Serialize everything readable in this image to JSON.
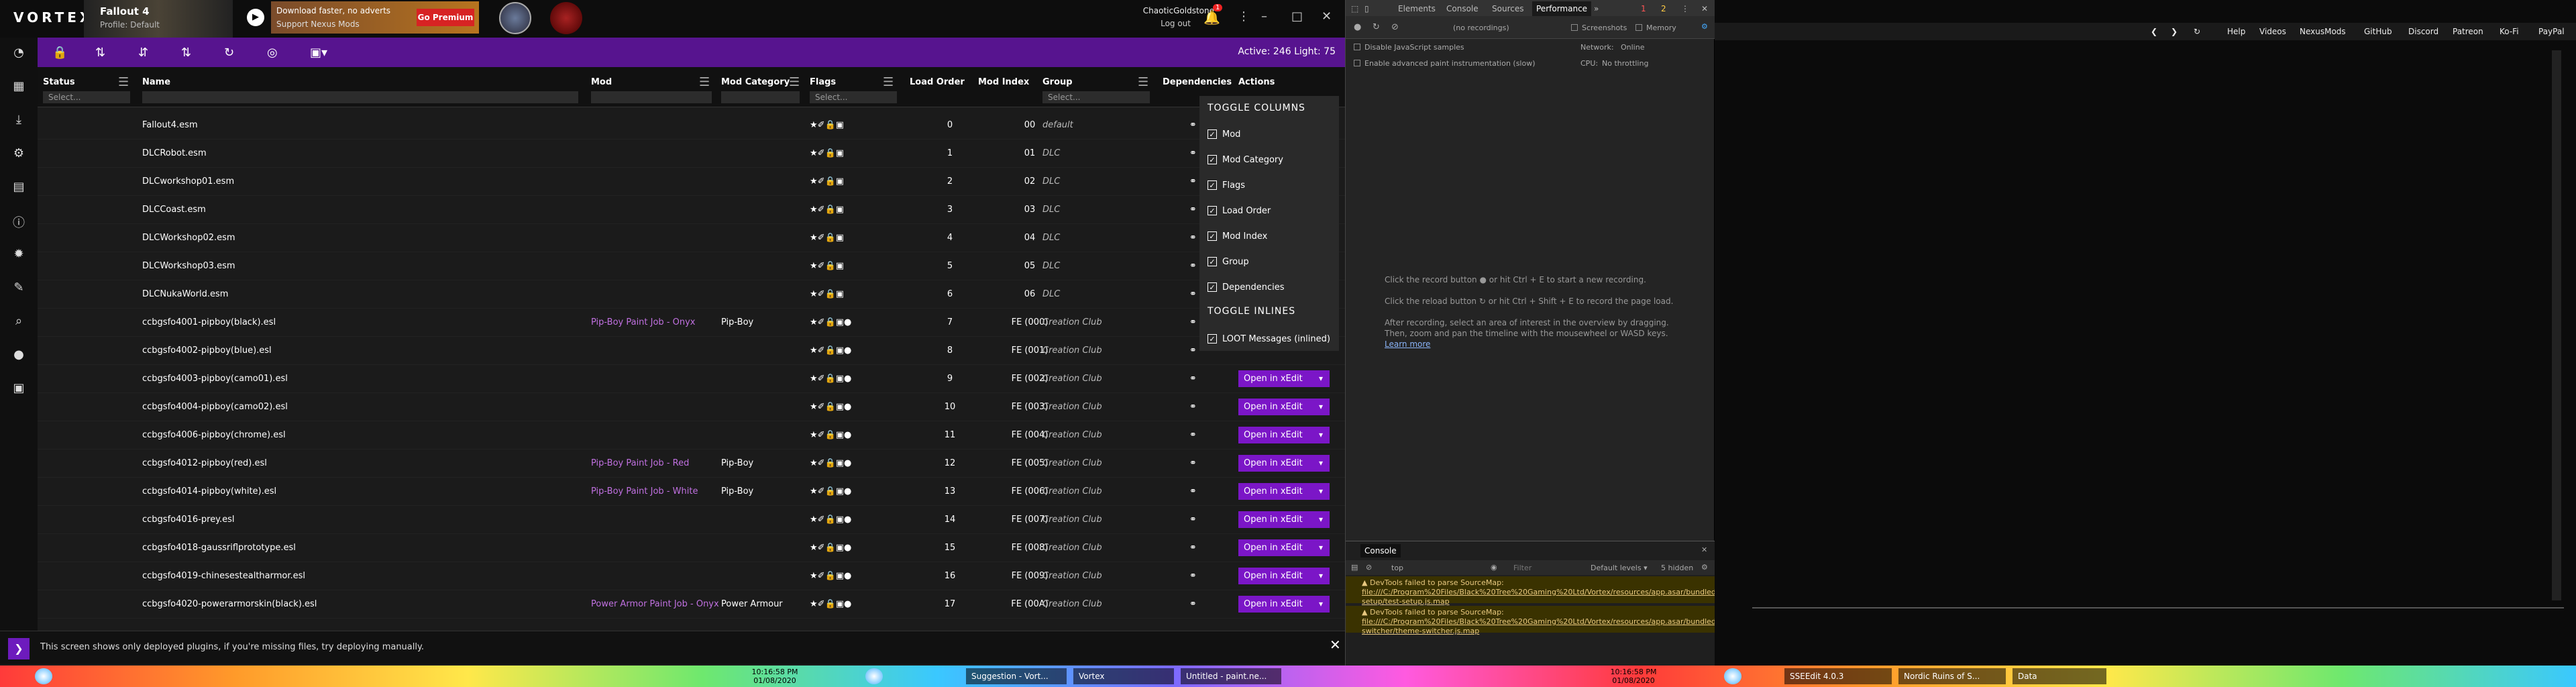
{
  "app": {
    "brand": "VORTEX",
    "game": "Fallout 4",
    "profile": "Profile: Default",
    "promo_title": "Download faster, no adverts",
    "promo_sub": "Support Nexus Mods",
    "premium": "Go Premium",
    "user": "ChaoticGoldstone",
    "logout": "Log out",
    "badge": "1",
    "active": "Active: 246 Light: 75"
  },
  "columns": {
    "status": "Status",
    "name": "Name",
    "mod": "Mod",
    "category": "Mod Category",
    "flags": "Flags",
    "load_order": "Load Order",
    "mod_index": "Mod Index",
    "group": "Group",
    "deps": "Dependencies",
    "actions": "Actions",
    "select": "Select..."
  },
  "rows": [
    {
      "name": "Fallout4.esm",
      "mod": "",
      "cat": "",
      "flags": "★✐🔒▣",
      "lo": "0",
      "mi": "00",
      "grp": "default",
      "xedit": ""
    },
    {
      "name": "DLCRobot.esm",
      "mod": "",
      "cat": "",
      "flags": "★✐🔒▣",
      "lo": "1",
      "mi": "01",
      "grp": "DLC",
      "xedit": ""
    },
    {
      "name": "DLCworkshop01.esm",
      "mod": "",
      "cat": "",
      "flags": "★✐🔒▣",
      "lo": "2",
      "mi": "02",
      "grp": "DLC",
      "xedit": ""
    },
    {
      "name": "DLCCoast.esm",
      "mod": "",
      "cat": "",
      "flags": "★✐🔒▣",
      "lo": "3",
      "mi": "03",
      "grp": "DLC",
      "xedit": ""
    },
    {
      "name": "DLCWorkshop02.esm",
      "mod": "",
      "cat": "",
      "flags": "★✐🔒▣",
      "lo": "4",
      "mi": "04",
      "grp": "DLC",
      "xedit": ""
    },
    {
      "name": "DLCWorkshop03.esm",
      "mod": "",
      "cat": "",
      "flags": "★✐🔒▣",
      "lo": "5",
      "mi": "05",
      "grp": "DLC",
      "xedit": ""
    },
    {
      "name": "DLCNukaWorld.esm",
      "mod": "",
      "cat": "",
      "flags": "★✐🔒▣",
      "lo": "6",
      "mi": "06",
      "grp": "DLC",
      "xedit": ""
    },
    {
      "name": "ccbgsfo4001-pipboy(black).esl",
      "mod": "Pip-Boy Paint Job - Onyx",
      "cat": "Pip-Boy",
      "flags": "★✐🔒▣●",
      "lo": "7",
      "mi": "FE (000)",
      "grp": "Creation Club",
      "xedit": ""
    },
    {
      "name": "ccbgsfo4002-pipboy(blue).esl",
      "mod": "",
      "cat": "",
      "flags": "★✐🔒▣●",
      "lo": "8",
      "mi": "FE (001)",
      "grp": "Creation Club",
      "xedit": ""
    },
    {
      "name": "ccbgsfo4003-pipboy(camo01).esl",
      "mod": "",
      "cat": "",
      "flags": "★✐🔒▣●",
      "lo": "9",
      "mi": "FE (002)",
      "grp": "Creation Club",
      "xedit": "Open in xEdit"
    },
    {
      "name": "ccbgsfo4004-pipboy(camo02).esl",
      "mod": "",
      "cat": "",
      "flags": "★✐🔒▣●",
      "lo": "10",
      "mi": "FE (003)",
      "grp": "Creation Club",
      "xedit": "Open in xEdit"
    },
    {
      "name": "ccbgsfo4006-pipboy(chrome).esl",
      "mod": "",
      "cat": "",
      "flags": "★✐🔒▣●",
      "lo": "11",
      "mi": "FE (004)",
      "grp": "Creation Club",
      "xedit": "Open in xEdit"
    },
    {
      "name": "ccbgsfo4012-pipboy(red).esl",
      "mod": "Pip-Boy Paint Job - Red",
      "cat": "Pip-Boy",
      "flags": "★✐🔒▣●",
      "lo": "12",
      "mi": "FE (005)",
      "grp": "Creation Club",
      "xedit": "Open in xEdit"
    },
    {
      "name": "ccbgsfo4014-pipboy(white).esl",
      "mod": "Pip-Boy Paint Job - White",
      "cat": "Pip-Boy",
      "flags": "★✐🔒▣●",
      "lo": "13",
      "mi": "FE (006)",
      "grp": "Creation Club",
      "xedit": "Open in xEdit"
    },
    {
      "name": "ccbgsfo4016-prey.esl",
      "mod": "",
      "cat": "",
      "flags": "★✐🔒▣●",
      "lo": "14",
      "mi": "FE (007)",
      "grp": "Creation Club",
      "xedit": "Open in xEdit"
    },
    {
      "name": "ccbgsfo4018-gaussriflprototype.esl",
      "mod": "",
      "cat": "",
      "flags": "★✐🔒▣●",
      "lo": "15",
      "mi": "FE (008)",
      "grp": "Creation Club",
      "xedit": "Open in xEdit"
    },
    {
      "name": "ccbgsfo4019-chinesestealtharmor.esl",
      "mod": "",
      "cat": "",
      "flags": "★✐🔒▣●",
      "lo": "16",
      "mi": "FE (009)",
      "grp": "Creation Club",
      "xedit": "Open in xEdit"
    },
    {
      "name": "ccbgsfo4020-powerarmorskin(black).esl",
      "mod": "Power Armor Paint Job - Onyx",
      "cat": "Power Armour",
      "flags": "★✐🔒▣●",
      "lo": "17",
      "mi": "FE (00A)",
      "grp": "Creation Club",
      "xedit": "Open in xEdit"
    }
  ],
  "toggle": {
    "cols_title": "TOGGLE COLUMNS",
    "items": [
      "Mod",
      "Mod Category",
      "Flags",
      "Load Order",
      "Mod Index",
      "Group",
      "Dependencies"
    ],
    "inl_title": "TOGGLE INLINES",
    "inl_items": [
      "LOOT Messages (inlined)"
    ]
  },
  "footer": {
    "text": "This screen shows only deployed plugins, if you're missing files, try deploying manually."
  },
  "devtools": {
    "tabs": [
      "Elements",
      "Console",
      "Sources",
      "Performance"
    ],
    "recording": "(no recordings)",
    "screenshots": "Screenshots",
    "memory": "Memory",
    "disable_js": "Disable JavaScript samples",
    "enable_paint": "Enable advanced paint instrumentation (slow)",
    "network": "Network:",
    "network_val": "Online",
    "cpu": "CPU:",
    "cpu_val": "No throttling",
    "h1a": "Click the record button",
    "h1b": "or hit Ctrl + E to start a new recording.",
    "h2a": "Click the reload button",
    "h2b": "or hit Ctrl + Shift + E to record the page load.",
    "h3": "After recording, select an area of interest in the overview by dragging.",
    "h4": "Then, zoom and pan the timeline with the mousewheel or WASD keys.",
    "h5": "Learn more",
    "console": "Console",
    "top": "top",
    "filter": "Filter",
    "levels": "Default levels ▾",
    "hidden": "5 hidden",
    "w1a": "DevTools failed to parse SourceMap:",
    "w1b": "file:///C:/Program%20Files/Black%20Tree%20Gaming%20Ltd/Vortex/resources/app.asar/bundledPlugins/test-setup/test-setup.js.map",
    "w2a": "DevTools failed to parse SourceMap:",
    "w2b": "file:///C:/Program%20Files/Black%20Tree%20Gaming%20Ltd/Vortex/resources/app.asar/bundledPlugins/theme-switcher/theme-switcher.js.map",
    "errors": "1",
    "warnings": "2"
  },
  "bookmarks": [
    "Help",
    "Videos",
    "NexusMods",
    "GitHub",
    "Discord",
    "Patreon",
    "Ko-Fi",
    "PayPal"
  ],
  "taskbar": {
    "clock1": "10:16:58 PM",
    "date1": "01/08/2020",
    "items": [
      "Suggestion - Vort...",
      "Vortex",
      "Untitled - paint.ne..."
    ],
    "clock2": "10:16:58 PM",
    "date2": "01/08/2020",
    "items2": [
      "SSEEdit 4.0.3",
      "Nordic Ruins of S...",
      "Data"
    ]
  }
}
